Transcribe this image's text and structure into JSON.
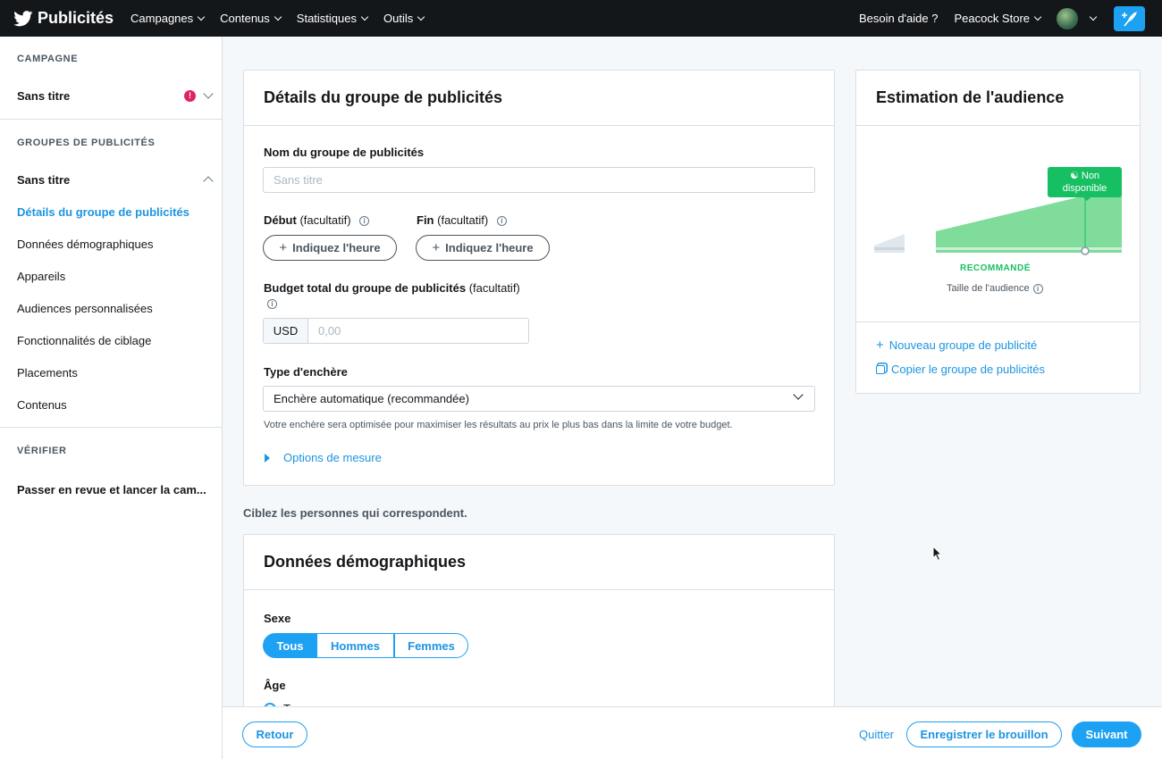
{
  "topbar": {
    "brand": "Publicités",
    "nav": [
      "Campagnes",
      "Contenus",
      "Statistiques",
      "Outils"
    ],
    "help": "Besoin d'aide ?",
    "account": "Peacock Store"
  },
  "sidebar": {
    "campaign_head": "CAMPAGNE",
    "campaign_name": "Sans titre",
    "campaign_error": "!",
    "groups_head": "GROUPES DE PUBLICITÉS",
    "group_name": "Sans titre",
    "items": [
      "Détails du groupe de publicités",
      "Données démographiques",
      "Appareils",
      "Audiences personnalisées",
      "Fonctionnalités de ciblage",
      "Placements",
      "Contenus"
    ],
    "verify_head": "VÉRIFIER",
    "review": "Passer en revue et lancer la cam..."
  },
  "details": {
    "title": "Détails du groupe de publicités",
    "name_label": "Nom du groupe de publicités",
    "name_placeholder": "Sans titre",
    "start_label": "Début",
    "end_label": "Fin",
    "optional": "(facultatif)",
    "time_button": "Indiquez l'heure",
    "budget_label": "Budget total du groupe de publicités",
    "currency": "USD",
    "budget_placeholder": "0,00",
    "bid_label": "Type d'enchère",
    "bid_value": "Enchère automatique (recommandée)",
    "bid_help": "Votre enchère sera optimisée pour maximiser les résultats au prix le plus bas dans la limite de votre budget.",
    "measure_options": "Options de mesure"
  },
  "target_text": "Ciblez les personnes qui correspondent.",
  "demographics": {
    "title": "Données démographiques",
    "sex_label": "Sexe",
    "sex_options": [
      "Tous",
      "Hommes",
      "Femmes"
    ],
    "sex_selected": "Tous",
    "age_label": "Âge",
    "age_partial": "T"
  },
  "audience": {
    "title": "Estimation de l'audience",
    "badge_line1": "Non",
    "badge_line2": "disponible",
    "recommended": "RECOMMANDÉ",
    "size_label": "Taille de l'audience",
    "new_group": "Nouveau groupe de publicité",
    "copy_group": "Copier le groupe de publicités",
    "colors": {
      "green": "#7fdc9a",
      "green_dark": "#17bf63",
      "badge": "#17bf63"
    }
  },
  "footer": {
    "back": "Retour",
    "quit": "Quitter",
    "save_draft": "Enregistrer le brouillon",
    "next": "Suivant"
  },
  "colors": {
    "accent": "#1da1f2",
    "topbar": "#14171a",
    "error": "#e0245e"
  }
}
